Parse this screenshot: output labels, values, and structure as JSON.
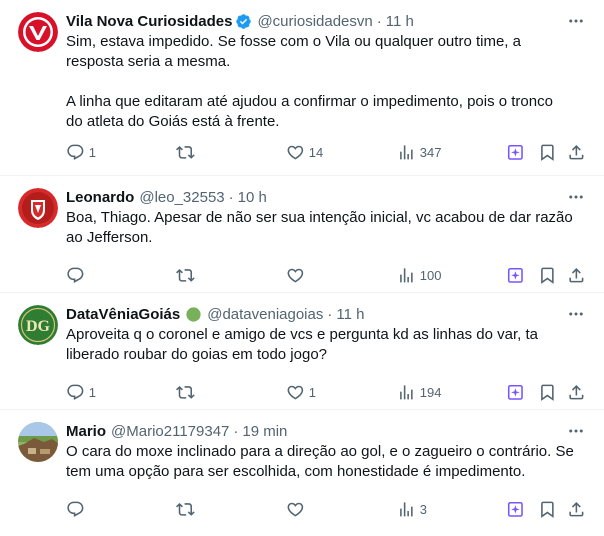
{
  "tweets": [
    {
      "name": "Vila Nova Curiosidades",
      "handle": "@curiosidadesvn",
      "time": "11 h",
      "verified": true,
      "text": "Sim, estava impedido. Se fosse com o Vila ou qualquer outro time, a\nresposta seria a mesma.\n\nA linha que editaram até ajudou a confirmar o impedimento, pois o tronco\ndo atleta do Goiás está à frente.",
      "replies": "1",
      "retweets": "",
      "likes": "14",
      "views": "347"
    },
    {
      "name": "Leonardo",
      "handle": "@leo_32553",
      "time": "10 h",
      "text": "Boa, Thiago. Apesar de não ser sua intenção inicial, vc acabou de dar razão\nao Jefferson.",
      "replies": "",
      "retweets": "",
      "likes": "",
      "views": "100"
    },
    {
      "name": "DataVêniaGoiás",
      "handle": "@dataveniagoias",
      "time": "11 h",
      "name_emoji": "green-circle",
      "text": "Aproveita q o coronel e amigo de vcs e pergunta kd as linhas do var, ta\nliberado roubar do goias em todo jogo?",
      "replies": "1",
      "retweets": "",
      "likes": "1",
      "views": "194"
    },
    {
      "name": "Mario",
      "handle": "@Mario21179347",
      "time": "19 min",
      "text": "O cara do moxe inclinado para a direção ao gol, e o zagueiro o contrário. Se\ntem uma opção para ser escolhida, com honestidade é impedimento.",
      "replies": "",
      "retweets": "",
      "likes": "",
      "views": "3"
    }
  ],
  "dot": "·",
  "colors": {
    "text": "#0f1419",
    "secondary": "#536471",
    "verified": "#1d9bf0",
    "grok": "#7856ff",
    "border": "#eff3f4"
  }
}
